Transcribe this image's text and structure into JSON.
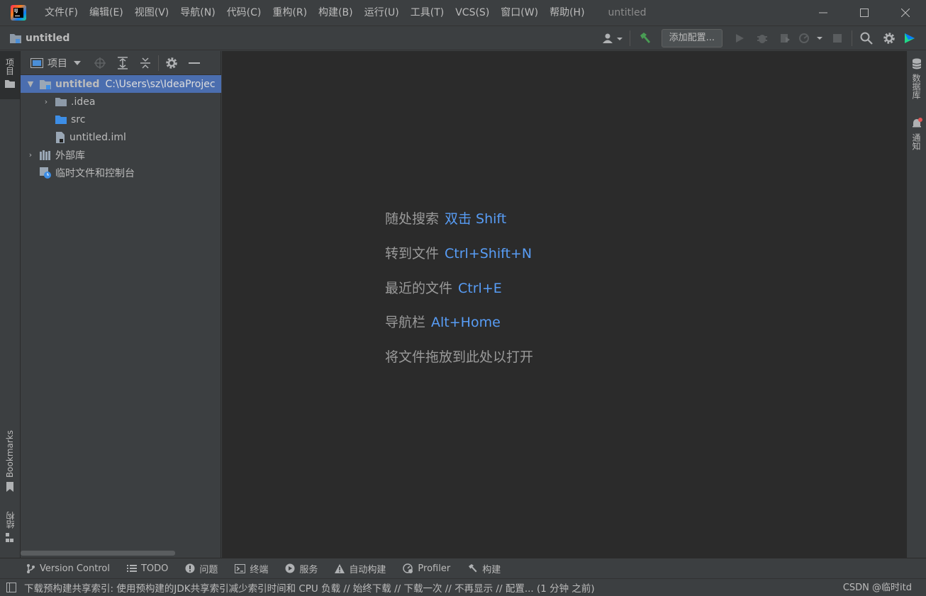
{
  "titlebar": {
    "menu": [
      "文件(F)",
      "编辑(E)",
      "视图(V)",
      "导航(N)",
      "代码(C)",
      "重构(R)",
      "构建(B)",
      "运行(U)",
      "工具(T)",
      "VCS(S)",
      "窗口(W)",
      "帮助(H)"
    ],
    "window_title": "untitled"
  },
  "navbar": {
    "project": "untitled",
    "add_config_label": "添加配置..."
  },
  "left_strip": {
    "project_tab": "项目",
    "bookmarks_tab": "Bookmarks",
    "structure_tab": "结构"
  },
  "project_panel": {
    "title": "项目",
    "tree": [
      {
        "label": "untitled",
        "path": "C:\\Users\\sz\\IdeaProjec",
        "icon": "module-folder-icon",
        "expanded": true,
        "selected": true
      },
      {
        "label": ".idea",
        "icon": "folder-icon",
        "expanded": false
      },
      {
        "label": "src",
        "icon": "source-folder-icon"
      },
      {
        "label": "untitled.iml",
        "icon": "iml-file-icon"
      },
      {
        "label": "外部库",
        "icon": "library-icon",
        "expanded": false
      },
      {
        "label": "临时文件和控制台",
        "icon": "scratch-icon"
      }
    ]
  },
  "editor": {
    "hints": [
      {
        "text": "随处搜索",
        "key": "双击 Shift"
      },
      {
        "text": "转到文件",
        "key": "Ctrl+Shift+N"
      },
      {
        "text": "最近的文件",
        "key": "Ctrl+E"
      },
      {
        "text": "导航栏",
        "key": "Alt+Home"
      },
      {
        "text": "将文件拖放到此处以打开",
        "key": ""
      }
    ]
  },
  "right_strip": {
    "database_tab": "数据库",
    "notifications_tab": "通知"
  },
  "bottom_tabs": [
    "Version Control",
    "TODO",
    "问题",
    "终端",
    "服务",
    "自动构建",
    "Profiler",
    "构建"
  ],
  "statusbar": {
    "message": "下载预构建共享索引: 使用预构建的JDK共享索引减少索引时间和 CPU 负载 // 始终下载 // 下载一次 // 不再显示 // 配置... (1 分钟 之前)",
    "watermark": "CSDN @临时itd"
  },
  "colors": {
    "background": "#3c3f41",
    "editor": "#2b2b2b",
    "selection": "#4b6eaf",
    "shortcut": "#589df6",
    "build_hammer": "#499c54"
  }
}
